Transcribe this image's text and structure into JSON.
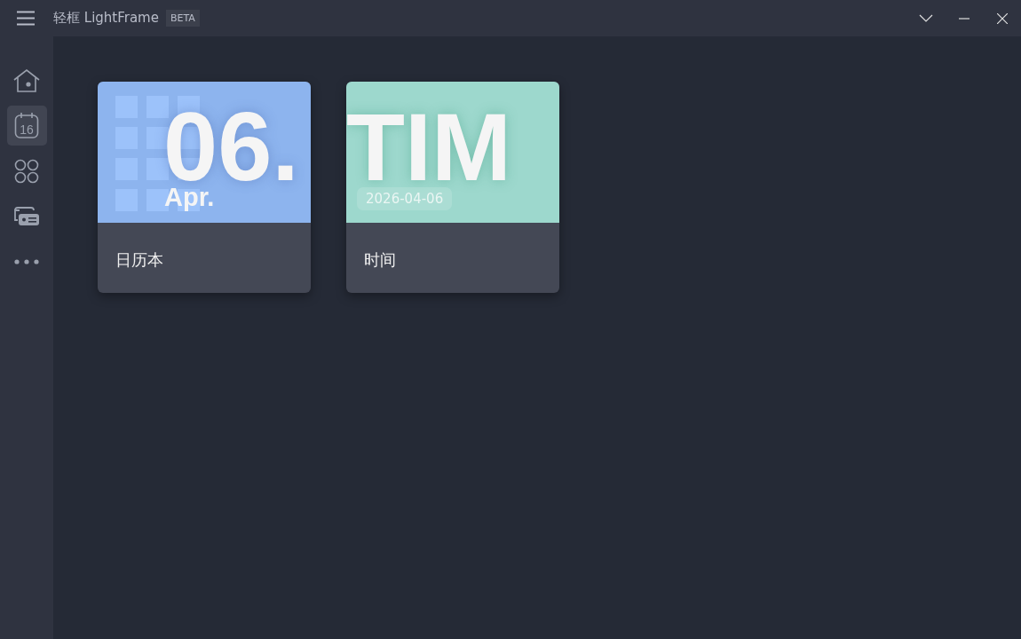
{
  "window": {
    "title": "轻框 LightFrame",
    "badge": "BETA"
  },
  "sidebar": {
    "items": [
      {
        "kind": "home",
        "selected": false
      },
      {
        "kind": "calendar",
        "day": "16",
        "selected": true
      },
      {
        "kind": "apps",
        "selected": false
      },
      {
        "kind": "cards",
        "selected": false
      },
      {
        "kind": "more",
        "selected": false
      }
    ]
  },
  "cards": [
    {
      "kind": "calendar",
      "big": "06.",
      "small": "Apr.",
      "label": "日历本"
    },
    {
      "kind": "time",
      "big": "TIM",
      "small": "2026-04-06",
      "label": "时间"
    }
  ]
}
